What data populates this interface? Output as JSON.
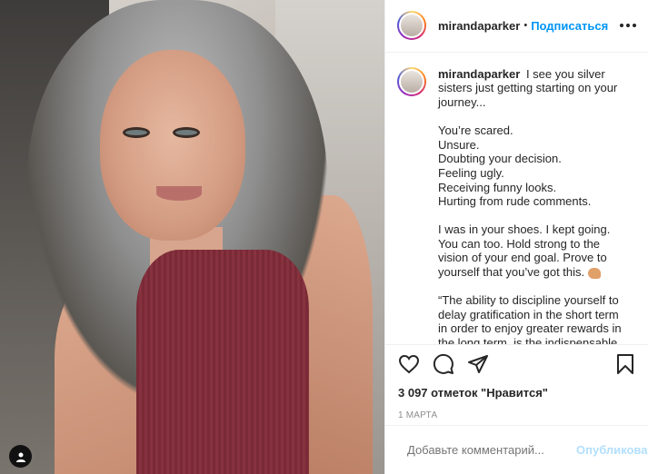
{
  "post": {
    "username": "mirandaparker",
    "follow_label": "Подписаться",
    "header_dot": "•",
    "caption": {
      "username": "mirandaparker",
      "intro": "I see you silver sisters just getting starting on your journey...",
      "lines": [
        "You’re scared.",
        "Unsure.",
        "Doubting your decision.",
        "Feeling ugly.",
        "Receiving funny looks.",
        "Hurting from rude comments."
      ],
      "paragraph2": "I was in your shoes. I kept going. You can too. Hold strong to the vision of your end goal. Prove to yourself that you’ve got this.",
      "quote": "“The ability to discipline yourself to delay gratification in the short term in order to enjoy greater rewards in the long term, is the indispensable prerequisite for success.”"
    },
    "likes": "3 097 отметок \"Нравится\"",
    "date": "1 МАРТА",
    "comment_placeholder": "Добавьте комментарий...",
    "publish_label": "Опубликовать"
  },
  "icons": {
    "more": "more-options-icon",
    "like": "heart-icon",
    "comment": "comment-icon",
    "share": "share-icon",
    "save": "bookmark-icon",
    "emoji": "smiley-icon",
    "user_tag": "user-tag-icon"
  },
  "colors": {
    "accent": "#0095f6",
    "publish_disabled": "#b2dffc",
    "muted": "#8e8e8e",
    "text": "#262626"
  }
}
